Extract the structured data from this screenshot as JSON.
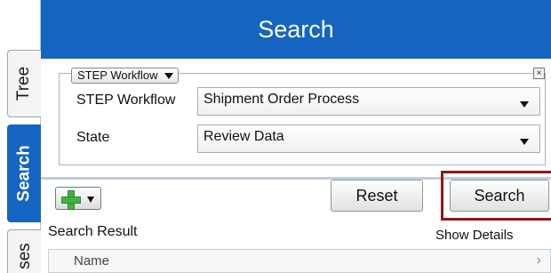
{
  "tabs": [
    {
      "label": "Tree",
      "active": false
    },
    {
      "label": "Search",
      "active": true
    },
    {
      "label": "ses",
      "active": false
    }
  ],
  "header": {
    "title": "Search"
  },
  "criteria": {
    "legend_select": "STEP Workflow",
    "close_glyph": "×",
    "workflow_label": "STEP Workflow",
    "workflow_value": "Shipment Order Process",
    "state_label": "State",
    "state_value": "Review Data"
  },
  "toolbar": {
    "reset_label": "Reset",
    "search_label": "Search"
  },
  "results": {
    "title": "Search Result",
    "show_details": "Show Details",
    "column_name": "Name",
    "chevron": "›"
  },
  "colors": {
    "accent": "#1565c0",
    "highlight": "#8b1a1a",
    "add_icon": "#3fb43f"
  },
  "icons": [
    "plus-icon",
    "dropdown-arrow-icon",
    "close-icon",
    "chevron-right-icon"
  ]
}
